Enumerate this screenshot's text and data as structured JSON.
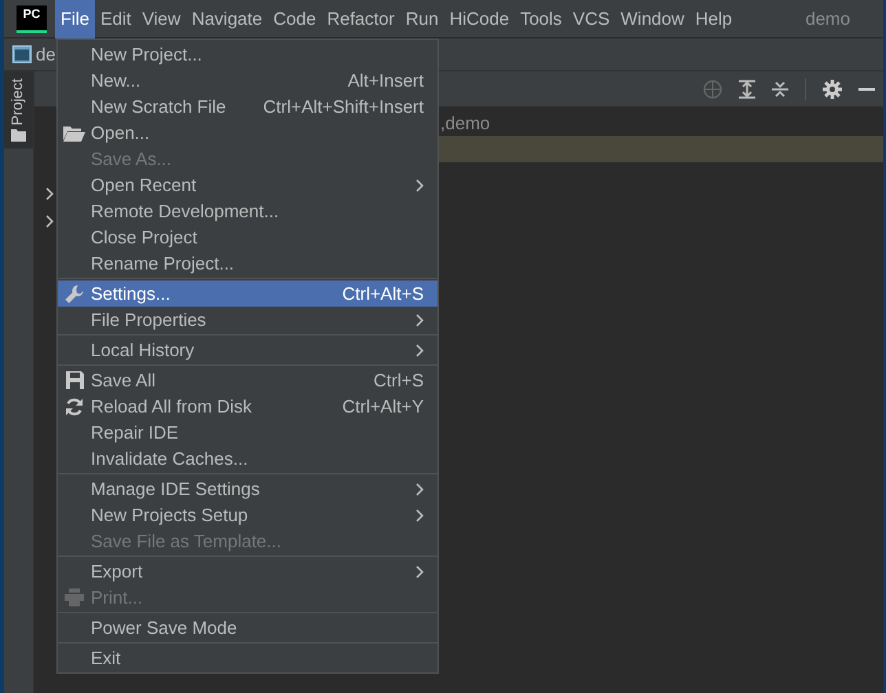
{
  "menubar": {
    "items": [
      {
        "label": "File",
        "selected": true
      },
      {
        "label": "Edit",
        "selected": false
      },
      {
        "label": "View",
        "selected": false
      },
      {
        "label": "Navigate",
        "selected": false
      },
      {
        "label": "Code",
        "selected": false
      },
      {
        "label": "Refactor",
        "selected": false
      },
      {
        "label": "Run",
        "selected": false
      },
      {
        "label": "HiCode",
        "selected": false
      },
      {
        "label": "Tools",
        "selected": false
      },
      {
        "label": "VCS",
        "selected": false
      },
      {
        "label": "Window",
        "selected": false
      },
      {
        "label": "Help",
        "selected": false
      }
    ],
    "project_name": "demo"
  },
  "logo": "PC",
  "navbar": {
    "crumb": "de"
  },
  "tool_stripe": {
    "tab": "Project",
    "selected": true
  },
  "tree": {
    "rows": [
      {
        "text": ",demo",
        "selected": false
      },
      {
        "text": "",
        "selected": true
      }
    ]
  },
  "file_menu": [
    {
      "kind": "item",
      "label": "New Project...",
      "disabled": false,
      "selected": false,
      "submenu": false
    },
    {
      "kind": "item",
      "label": "New...",
      "shortcut": "Alt+Insert",
      "disabled": false,
      "selected": false,
      "submenu": false
    },
    {
      "kind": "item",
      "label": "New Scratch File",
      "shortcut": "Ctrl+Alt+Shift+Insert",
      "disabled": false,
      "selected": false,
      "submenu": false
    },
    {
      "kind": "item",
      "label": "Open...",
      "disabled": false,
      "selected": false,
      "submenu": false
    },
    {
      "kind": "item",
      "label": "Save As...",
      "disabled": true,
      "selected": false,
      "submenu": false
    },
    {
      "kind": "item",
      "label": "Open Recent",
      "disabled": false,
      "selected": false,
      "submenu": true
    },
    {
      "kind": "item",
      "label": "Remote Development...",
      "disabled": false,
      "selected": false,
      "submenu": false
    },
    {
      "kind": "item",
      "label": "Close Project",
      "disabled": false,
      "selected": false,
      "submenu": false
    },
    {
      "kind": "item",
      "label": "Rename Project...",
      "disabled": false,
      "selected": false,
      "submenu": false
    },
    {
      "kind": "separator"
    },
    {
      "kind": "item",
      "label": "Settings...",
      "shortcut": "Ctrl+Alt+S",
      "disabled": false,
      "selected": true,
      "submenu": false
    },
    {
      "kind": "item",
      "label": "File Properties",
      "disabled": false,
      "selected": false,
      "submenu": true
    },
    {
      "kind": "separator"
    },
    {
      "kind": "item",
      "label": "Local History",
      "disabled": false,
      "selected": false,
      "submenu": true
    },
    {
      "kind": "separator"
    },
    {
      "kind": "item",
      "label": "Save All",
      "shortcut": "Ctrl+S",
      "disabled": false,
      "selected": false,
      "submenu": false
    },
    {
      "kind": "item",
      "label": "Reload All from Disk",
      "shortcut": "Ctrl+Alt+Y",
      "disabled": false,
      "selected": false,
      "submenu": false
    },
    {
      "kind": "item",
      "label": "Repair IDE",
      "disabled": false,
      "selected": false,
      "submenu": false
    },
    {
      "kind": "item",
      "label": "Invalidate Caches...",
      "disabled": false,
      "selected": false,
      "submenu": false
    },
    {
      "kind": "separator"
    },
    {
      "kind": "item",
      "label": "Manage IDE Settings",
      "disabled": false,
      "selected": false,
      "submenu": true
    },
    {
      "kind": "item",
      "label": "New Projects Setup",
      "disabled": false,
      "selected": false,
      "submenu": true
    },
    {
      "kind": "item",
      "label": "Save File as Template...",
      "disabled": true,
      "selected": false,
      "submenu": false
    },
    {
      "kind": "separator"
    },
    {
      "kind": "item",
      "label": "Export",
      "disabled": false,
      "selected": false,
      "submenu": true
    },
    {
      "kind": "item",
      "label": "Print...",
      "disabled": true,
      "selected": false,
      "submenu": false
    },
    {
      "kind": "separator"
    },
    {
      "kind": "item",
      "label": "Power Save Mode",
      "disabled": false,
      "selected": false,
      "submenu": false
    },
    {
      "kind": "separator"
    },
    {
      "kind": "item",
      "label": "Exit",
      "disabled": false,
      "selected": false,
      "submenu": false
    }
  ]
}
